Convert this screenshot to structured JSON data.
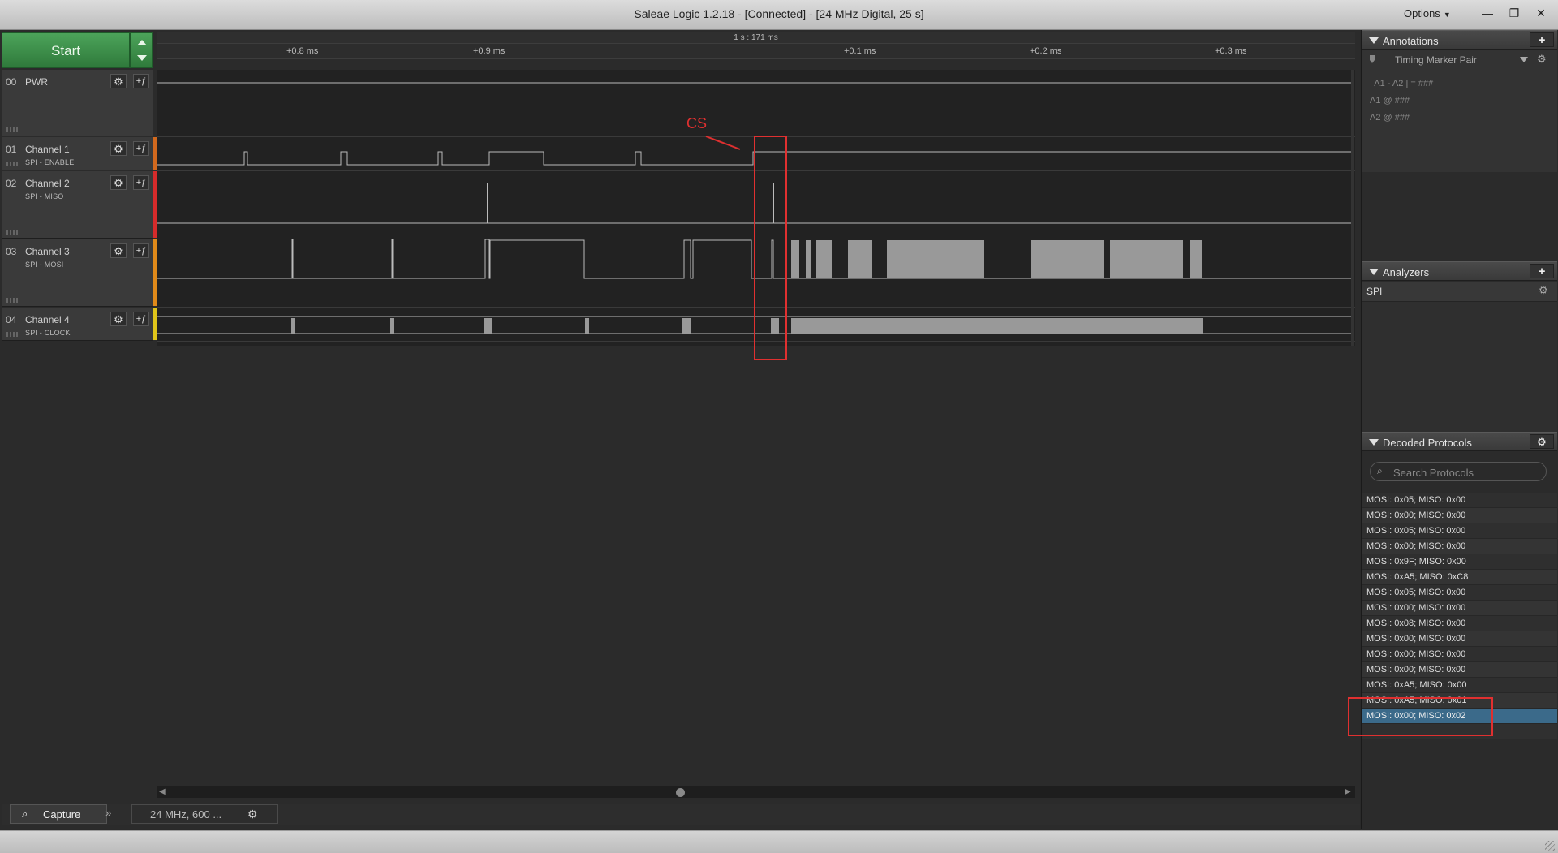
{
  "window": {
    "title": "Saleae Logic 1.2.18 - [Connected] - [24 MHz Digital, 25 s]",
    "options_label": "Options",
    "minimize_icon": "minimize-icon",
    "restore_icon": "restore-icon",
    "close_icon": "close-icon"
  },
  "toolbar": {
    "start_label": "Start"
  },
  "timeline": {
    "scale_label": "1 s : 171 ms",
    "ticks": [
      "+0.8 ms",
      "+0.9 ms",
      "+0.1 ms",
      "+0.2 ms",
      "+0.3 ms"
    ]
  },
  "channels": [
    {
      "num": "00",
      "name": "PWR",
      "sub": "",
      "color": ""
    },
    {
      "num": "01",
      "name": "Channel 1",
      "sub": "SPI - ENABLE",
      "color": "#d2691e"
    },
    {
      "num": "02",
      "name": "Channel 2",
      "sub": "SPI - MISO",
      "color": "#d62b2b"
    },
    {
      "num": "03",
      "name": "Channel 3",
      "sub": "SPI - MOSI",
      "color": "#e08a1a"
    },
    {
      "num": "04",
      "name": "Channel 4",
      "sub": "SPI - CLOCK",
      "color": "#e0c51a"
    }
  ],
  "annotation": {
    "label": "CS",
    "color": "#e03030"
  },
  "bottom": {
    "capture_label": "Capture",
    "rate_label": "24 MHz, 600 ..."
  },
  "panels": {
    "annotations": {
      "title": "Annotations",
      "marker_label": "Timing Marker Pair",
      "line1": "| A1 - A2 | = ###",
      "line2": "A1  @  ###",
      "line3": "A2  @  ###"
    },
    "analyzers": {
      "title": "Analyzers",
      "items": [
        "SPI"
      ]
    },
    "decoded": {
      "title": "Decoded Protocols",
      "search_placeholder": "Search Protocols",
      "rows": [
        "MOSI: 0x05;  MISO: 0x00",
        "MOSI: 0x00;  MISO: 0x00",
        "MOSI: 0x05;  MISO: 0x00",
        "MOSI: 0x00;  MISO: 0x00",
        "MOSI: 0x9F;  MISO: 0x00",
        "MOSI: 0xA5;  MISO: 0xC8",
        "MOSI: 0x05;  MISO: 0x00",
        "MOSI: 0x00;  MISO: 0x00",
        "MOSI: 0x08;  MISO: 0x00",
        "MOSI: 0x00;  MISO: 0x00",
        "MOSI: 0x00;  MISO: 0x00",
        "MOSI: 0x00;  MISO: 0x00",
        "MOSI: 0xA5;  MISO: 0x00",
        "MOSI: 0xA5;  MISO: 0x01",
        "MOSI: 0x00;  MISO: 0x02"
      ],
      "selected_index": 14
    }
  }
}
